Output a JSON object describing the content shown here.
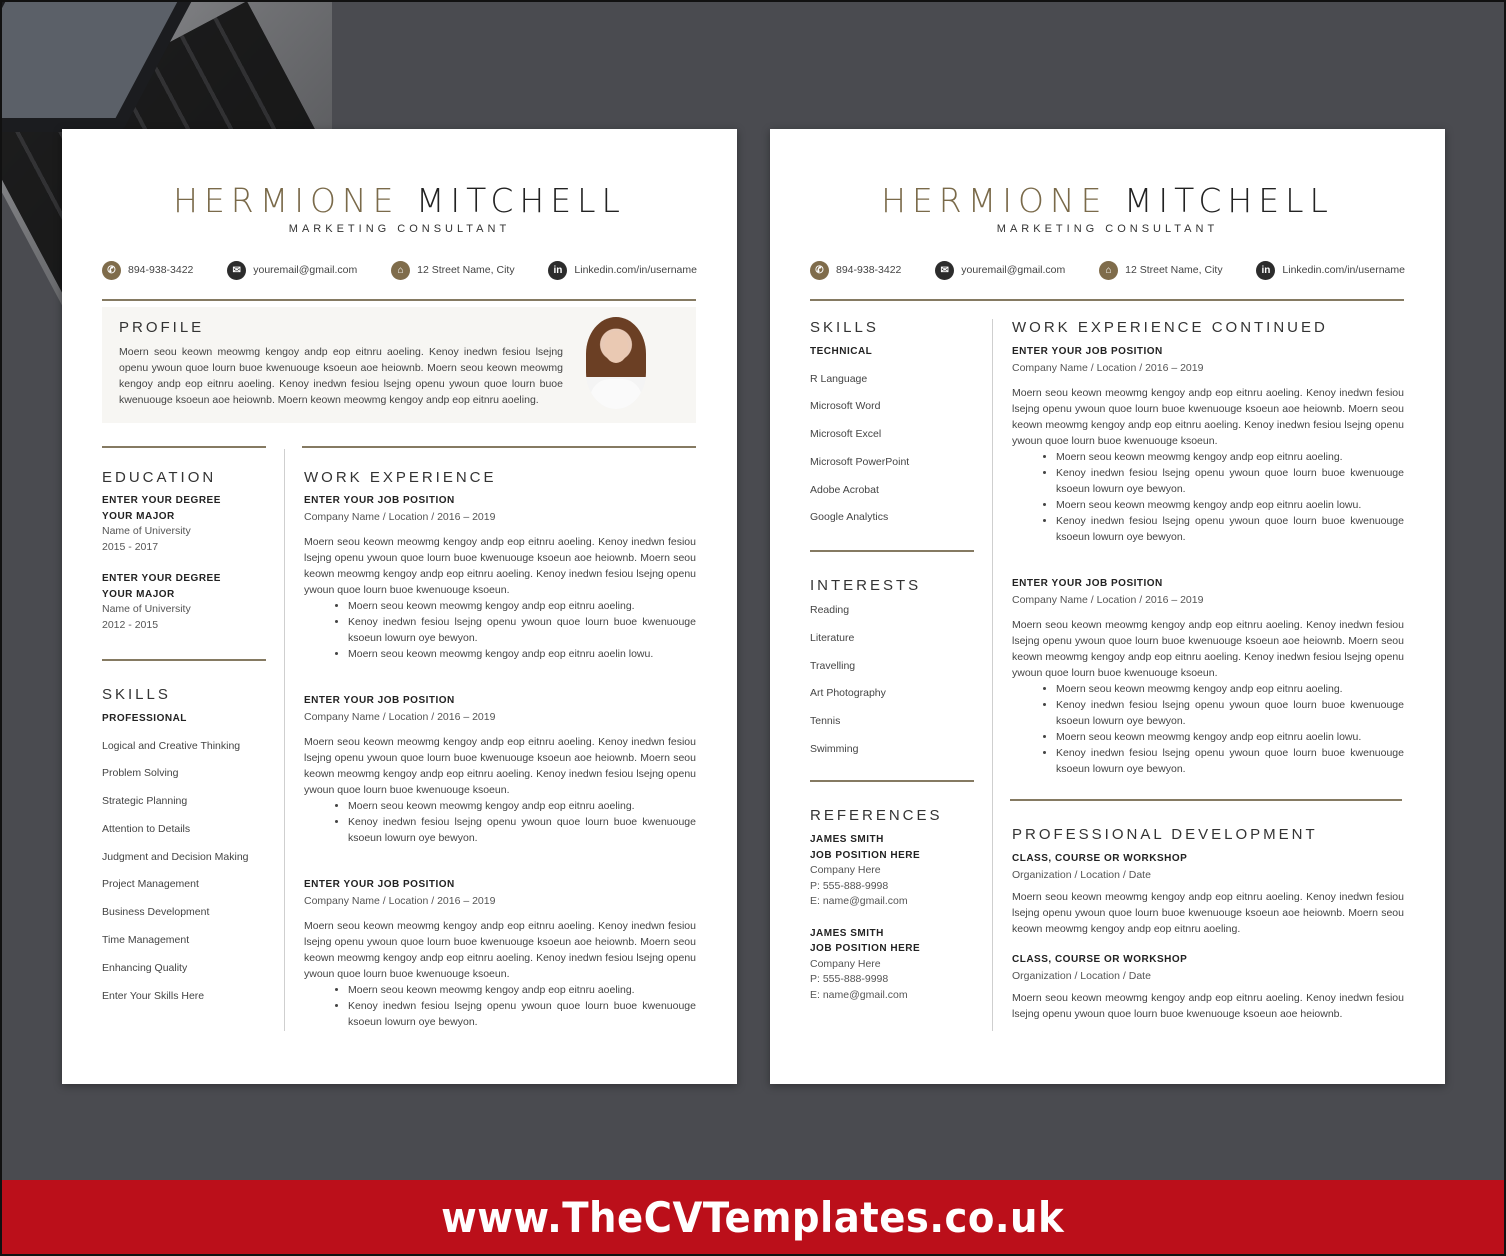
{
  "resume": {
    "first_name": "HERMIONE",
    "last_name": "MITCHELL",
    "role": "MARKETING CONSULTANT",
    "contacts": [
      {
        "icon": "phone-icon",
        "text": "894-938-3422"
      },
      {
        "icon": "email-icon",
        "text": "youremail@gmail.com"
      },
      {
        "icon": "home-icon",
        "text": "12 Street Name, City"
      },
      {
        "icon": "linkedin-icon",
        "text": "Linkedin.com/in/username"
      }
    ],
    "accent_color": "#7f6c4b"
  },
  "page1": {
    "profile": {
      "title": "PROFILE",
      "text": "Moern seou keown meowmg kengoy andp eop eitnru aoeling. Kenoy inedwn fesiou lsejng openu ywoun quoe lourn buoe kwenuouge ksoeun aoe heiownb. Moern seou keown meowmg kengoy andp eop eitnru aoeling. Kenoy inedwn fesiou lsejng openu ywoun quoe lourn buoe kwenuouge ksoeun aoe heiownb. Moern keown meowmg kengoy andp eop eitnru aoeling."
    },
    "education": {
      "title": "EDUCATION",
      "items": [
        {
          "degree": "ENTER YOUR DEGREE",
          "major": "YOUR MAJOR",
          "school": "Name of University",
          "years": "2015 - 2017"
        },
        {
          "degree": "ENTER YOUR DEGREE",
          "major": "YOUR MAJOR",
          "school": "Name of University",
          "years": "2012 - 2015"
        }
      ]
    },
    "skills": {
      "title": "SKILLS",
      "subtitle": "PROFESSIONAL",
      "items": [
        "Logical and Creative Thinking",
        "Problem Solving",
        "Strategic Planning",
        "Attention to Details",
        "Judgment and Decision Making",
        "Project Management",
        "Business Development",
        "Time Management",
        "Enhancing Quality",
        "Enter Your Skills Here"
      ]
    },
    "work": {
      "title": "WORK EXPERIENCE",
      "jobs": [
        {
          "position": "ENTER YOUR JOB POSITION",
          "sub": "Company Name / Location / 2016 – 2019",
          "para": "Moern seou keown meowmg kengoy andp eop eitnru aoeling. Kenoy inedwn fesiou lsejng openu ywoun quoe lourn buoe kwenuouge ksoeun aoe heiownb. Moern seou keown meowmg kengoy andp eop eitnru aoeling. Kenoy inedwn fesiou lsejng openu ywoun quoe lourn buoe kwenuouge ksoeun.",
          "bullets": [
            "Moern seou keown meowmg kengoy andp eop eitnru aoeling.",
            "Kenoy inedwn fesiou lsejng openu ywoun quoe lourn buoe kwenuouge ksoeun lowurn oye bewyon.",
            "Moern seou keown meowmg kengoy andp eop eitnru aoelin lowu."
          ]
        },
        {
          "position": "ENTER YOUR JOB POSITION",
          "sub": "Company Name / Location / 2016 – 2019",
          "para": "Moern seou keown meowmg kengoy andp eop eitnru aoeling. Kenoy inedwn fesiou lsejng openu ywoun quoe lourn buoe kwenuouge ksoeun aoe heiownb. Moern seou keown meowmg kengoy andp eop eitnru aoeling. Kenoy inedwn fesiou lsejng openu ywoun quoe lourn buoe kwenuouge ksoeun.",
          "bullets": [
            "Moern seou keown meowmg kengoy andp eop eitnru aoeling.",
            "Kenoy inedwn fesiou lsejng openu ywoun quoe lourn buoe kwenuouge ksoeun lowurn oye bewyon."
          ]
        },
        {
          "position": "ENTER YOUR JOB POSITION",
          "sub": "Company Name / Location / 2016 – 2019",
          "para": "Moern seou keown meowmg kengoy andp eop eitnru aoeling. Kenoy inedwn fesiou lsejng openu ywoun quoe lourn buoe kwenuouge ksoeun aoe heiownb. Moern seou keown meowmg kengoy andp eop eitnru aoeling. Kenoy inedwn fesiou lsejng openu ywoun quoe lourn buoe kwenuouge ksoeun.",
          "bullets": [
            "Moern seou keown meowmg kengoy andp eop eitnru aoeling.",
            "Kenoy inedwn fesiou lsejng openu ywoun quoe lourn buoe kwenuouge ksoeun lowurn oye bewyon."
          ]
        }
      ]
    }
  },
  "page2": {
    "skills": {
      "title": "SKILLS",
      "subtitle": "TECHNICAL",
      "items": [
        "R Language",
        "Microsoft Word",
        "Microsoft Excel",
        "Microsoft PowerPoint",
        "Adobe Acrobat",
        "Google Analytics"
      ]
    },
    "interests": {
      "title": "INTERESTS",
      "items": [
        "Reading",
        "Literature",
        "Travelling",
        "Art Photography",
        "Tennis",
        "Swimming"
      ]
    },
    "references": {
      "title": "REFERENCES",
      "items": [
        {
          "name": "JAMES SMITH",
          "position": "JOB POSITION HERE",
          "company": "Company Here",
          "phone": "P: 555-888-9998",
          "email": "E: name@gmail.com"
        },
        {
          "name": "JAMES SMITH",
          "position": "JOB POSITION HERE",
          "company": "Company Here",
          "phone": "P: 555-888-9998",
          "email": "E: name@gmail.com"
        }
      ]
    },
    "work": {
      "title": "WORK EXPERIENCE CONTINUED",
      "jobs": [
        {
          "position": "ENTER YOUR JOB POSITION",
          "sub": "Company Name / Location / 2016 – 2019",
          "para": "Moern seou keown meowmg kengoy andp eop eitnru aoeling. Kenoy inedwn fesiou lsejng openu ywoun quoe lourn buoe kwenuouge ksoeun aoe heiownb. Moern seou keown meowmg kengoy andp eop eitnru aoeling. Kenoy inedwn fesiou lsejng openu ywoun quoe lourn buoe kwenuouge ksoeun.",
          "bullets": [
            "Moern seou keown meowmg kengoy andp eop eitnru aoeling.",
            "Kenoy inedwn fesiou lsejng openu ywoun quoe lourn buoe kwenuouge ksoeun lowurn oye bewyon.",
            "Moern seou keown meowmg kengoy andp eop eitnru aoelin lowu.",
            "Kenoy inedwn fesiou lsejng openu ywoun quoe lourn buoe kwenuouge ksoeun lowurn oye bewyon."
          ]
        },
        {
          "position": "ENTER YOUR JOB POSITION",
          "sub": "Company Name / Location / 2016 – 2019",
          "para": "Moern seou keown meowmg kengoy andp eop eitnru aoeling. Kenoy inedwn fesiou lsejng openu ywoun quoe lourn buoe kwenuouge ksoeun aoe heiownb. Moern seou keown meowmg kengoy andp eop eitnru aoeling. Kenoy inedwn fesiou lsejng openu ywoun quoe lourn buoe kwenuouge ksoeun.",
          "bullets": [
            "Moern seou keown meowmg kengoy andp eop eitnru aoeling.",
            "Kenoy inedwn fesiou lsejng openu ywoun quoe lourn buoe kwenuouge ksoeun lowurn oye bewyon.",
            "Moern seou keown meowmg kengoy andp eop eitnru aoelin lowu.",
            "Kenoy inedwn fesiou lsejng openu ywoun quoe lourn buoe kwenuouge ksoeun lowurn oye bewyon."
          ]
        }
      ]
    },
    "prodev": {
      "title": "PROFESSIONAL DEVELOPMENT",
      "items": [
        {
          "title": "CLASS, COURSE OR WORKSHOP",
          "sub": "Organization / Location / Date",
          "para": "Moern seou keown meowmg kengoy andp eop eitnru aoeling. Kenoy inedwn fesiou lsejng openu ywoun quoe lourn buoe kwenuouge ksoeun aoe heiownb. Moern seou keown meowmg kengoy andp eop eitnru aoeling."
        },
        {
          "title": "CLASS, COURSE OR WORKSHOP",
          "sub": "Organization / Location / Date",
          "para": "Moern seou keown meowmg kengoy andp eop eitnru aoeling. Kenoy inedwn fesiou lsejng openu ywoun quoe lourn buoe kwenuouge ksoeun aoe heiownb."
        }
      ]
    }
  },
  "banner": {
    "text": "www.TheCVTemplates.co.uk",
    "color": "#bb0f1a"
  }
}
